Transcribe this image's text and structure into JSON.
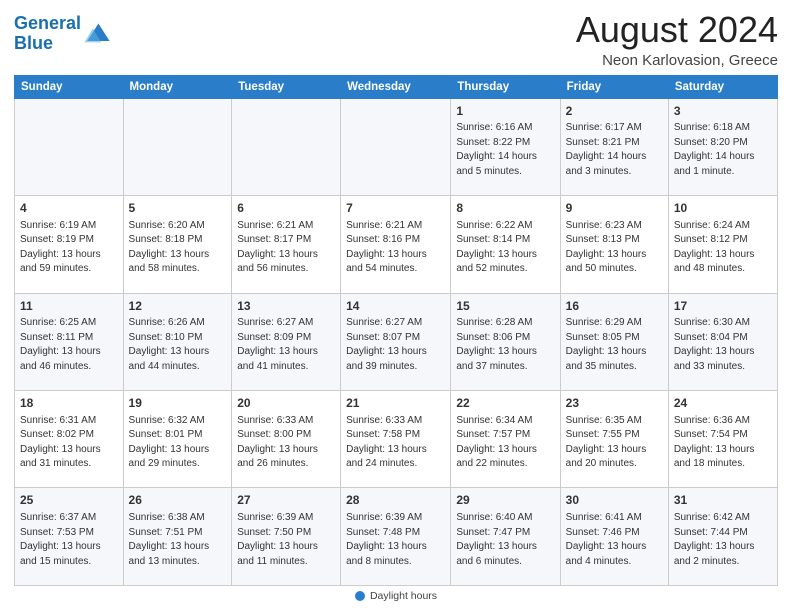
{
  "header": {
    "logo_line1": "General",
    "logo_line2": "Blue",
    "month_year": "August 2024",
    "location": "Neon Karlovasion, Greece"
  },
  "footer": {
    "label": "Daylight hours"
  },
  "days_of_week": [
    "Sunday",
    "Monday",
    "Tuesday",
    "Wednesday",
    "Thursday",
    "Friday",
    "Saturday"
  ],
  "weeks": [
    [
      {
        "day": "",
        "info": ""
      },
      {
        "day": "",
        "info": ""
      },
      {
        "day": "",
        "info": ""
      },
      {
        "day": "",
        "info": ""
      },
      {
        "day": "1",
        "info": "Sunrise: 6:16 AM\nSunset: 8:22 PM\nDaylight: 14 hours\nand 5 minutes."
      },
      {
        "day": "2",
        "info": "Sunrise: 6:17 AM\nSunset: 8:21 PM\nDaylight: 14 hours\nand 3 minutes."
      },
      {
        "day": "3",
        "info": "Sunrise: 6:18 AM\nSunset: 8:20 PM\nDaylight: 14 hours\nand 1 minute."
      }
    ],
    [
      {
        "day": "4",
        "info": "Sunrise: 6:19 AM\nSunset: 8:19 PM\nDaylight: 13 hours\nand 59 minutes."
      },
      {
        "day": "5",
        "info": "Sunrise: 6:20 AM\nSunset: 8:18 PM\nDaylight: 13 hours\nand 58 minutes."
      },
      {
        "day": "6",
        "info": "Sunrise: 6:21 AM\nSunset: 8:17 PM\nDaylight: 13 hours\nand 56 minutes."
      },
      {
        "day": "7",
        "info": "Sunrise: 6:21 AM\nSunset: 8:16 PM\nDaylight: 13 hours\nand 54 minutes."
      },
      {
        "day": "8",
        "info": "Sunrise: 6:22 AM\nSunset: 8:14 PM\nDaylight: 13 hours\nand 52 minutes."
      },
      {
        "day": "9",
        "info": "Sunrise: 6:23 AM\nSunset: 8:13 PM\nDaylight: 13 hours\nand 50 minutes."
      },
      {
        "day": "10",
        "info": "Sunrise: 6:24 AM\nSunset: 8:12 PM\nDaylight: 13 hours\nand 48 minutes."
      }
    ],
    [
      {
        "day": "11",
        "info": "Sunrise: 6:25 AM\nSunset: 8:11 PM\nDaylight: 13 hours\nand 46 minutes."
      },
      {
        "day": "12",
        "info": "Sunrise: 6:26 AM\nSunset: 8:10 PM\nDaylight: 13 hours\nand 44 minutes."
      },
      {
        "day": "13",
        "info": "Sunrise: 6:27 AM\nSunset: 8:09 PM\nDaylight: 13 hours\nand 41 minutes."
      },
      {
        "day": "14",
        "info": "Sunrise: 6:27 AM\nSunset: 8:07 PM\nDaylight: 13 hours\nand 39 minutes."
      },
      {
        "day": "15",
        "info": "Sunrise: 6:28 AM\nSunset: 8:06 PM\nDaylight: 13 hours\nand 37 minutes."
      },
      {
        "day": "16",
        "info": "Sunrise: 6:29 AM\nSunset: 8:05 PM\nDaylight: 13 hours\nand 35 minutes."
      },
      {
        "day": "17",
        "info": "Sunrise: 6:30 AM\nSunset: 8:04 PM\nDaylight: 13 hours\nand 33 minutes."
      }
    ],
    [
      {
        "day": "18",
        "info": "Sunrise: 6:31 AM\nSunset: 8:02 PM\nDaylight: 13 hours\nand 31 minutes."
      },
      {
        "day": "19",
        "info": "Sunrise: 6:32 AM\nSunset: 8:01 PM\nDaylight: 13 hours\nand 29 minutes."
      },
      {
        "day": "20",
        "info": "Sunrise: 6:33 AM\nSunset: 8:00 PM\nDaylight: 13 hours\nand 26 minutes."
      },
      {
        "day": "21",
        "info": "Sunrise: 6:33 AM\nSunset: 7:58 PM\nDaylight: 13 hours\nand 24 minutes."
      },
      {
        "day": "22",
        "info": "Sunrise: 6:34 AM\nSunset: 7:57 PM\nDaylight: 13 hours\nand 22 minutes."
      },
      {
        "day": "23",
        "info": "Sunrise: 6:35 AM\nSunset: 7:55 PM\nDaylight: 13 hours\nand 20 minutes."
      },
      {
        "day": "24",
        "info": "Sunrise: 6:36 AM\nSunset: 7:54 PM\nDaylight: 13 hours\nand 18 minutes."
      }
    ],
    [
      {
        "day": "25",
        "info": "Sunrise: 6:37 AM\nSunset: 7:53 PM\nDaylight: 13 hours\nand 15 minutes."
      },
      {
        "day": "26",
        "info": "Sunrise: 6:38 AM\nSunset: 7:51 PM\nDaylight: 13 hours\nand 13 minutes."
      },
      {
        "day": "27",
        "info": "Sunrise: 6:39 AM\nSunset: 7:50 PM\nDaylight: 13 hours\nand 11 minutes."
      },
      {
        "day": "28",
        "info": "Sunrise: 6:39 AM\nSunset: 7:48 PM\nDaylight: 13 hours\nand 8 minutes."
      },
      {
        "day": "29",
        "info": "Sunrise: 6:40 AM\nSunset: 7:47 PM\nDaylight: 13 hours\nand 6 minutes."
      },
      {
        "day": "30",
        "info": "Sunrise: 6:41 AM\nSunset: 7:46 PM\nDaylight: 13 hours\nand 4 minutes."
      },
      {
        "day": "31",
        "info": "Sunrise: 6:42 AM\nSunset: 7:44 PM\nDaylight: 13 hours\nand 2 minutes."
      }
    ]
  ]
}
